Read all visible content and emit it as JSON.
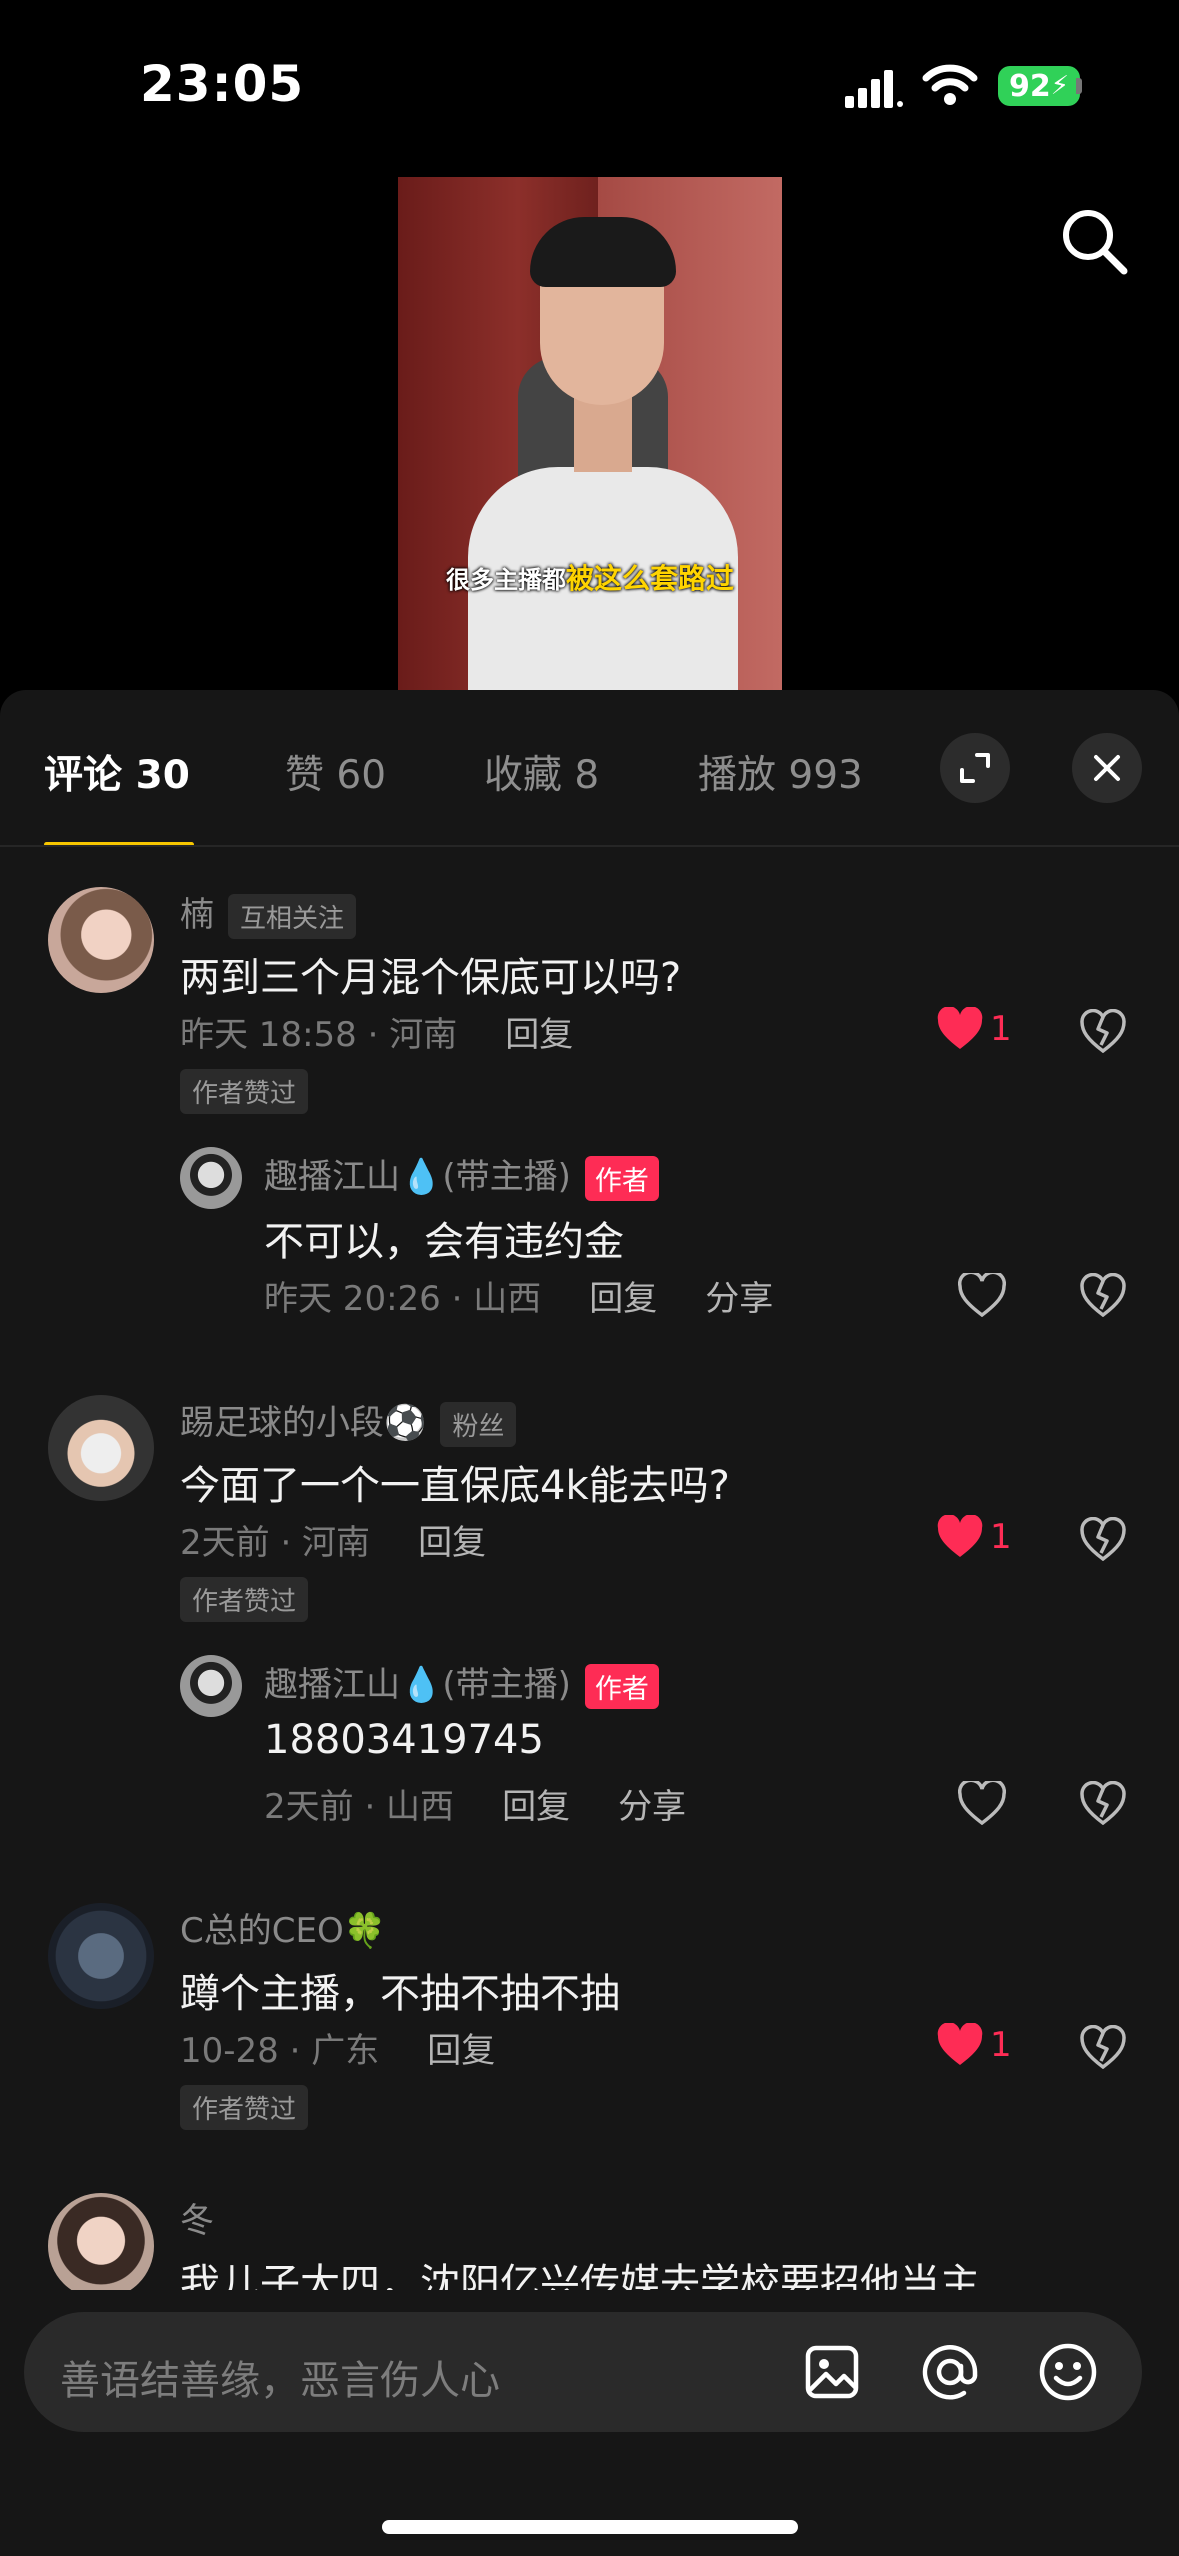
{
  "status": {
    "time": "23:05",
    "battery": "92"
  },
  "video": {
    "caption_plain": "很多主播都",
    "caption_highlight": "被这么套路过"
  },
  "tabs": {
    "comments": "评论 30",
    "likes": "赞 60",
    "favorites": "收藏 8",
    "plays": "播放 993"
  },
  "comments": [
    {
      "name": "楠",
      "badge": "互相关注",
      "text": "两到三个月混个保底可以吗?",
      "meta": "昨天 18:58 · 河南",
      "reply": "回复",
      "like_count": "1",
      "liked_label": "作者赞过",
      "reply_item": {
        "name": "趣播江山💧(带主播)",
        "badge": "作者",
        "text": "不可以，会有违约金",
        "meta": "昨天 20:26 · 山西",
        "reply": "回复",
        "share": "分享"
      }
    },
    {
      "name": "踢足球的小段⚽",
      "badge": "粉丝",
      "text": "今面了一个一直保底4k能去吗?",
      "meta": "2天前 · 河南",
      "reply": "回复",
      "like_count": "1",
      "liked_label": "作者赞过",
      "reply_item": {
        "name": "趣播江山💧(带主播)",
        "badge": "作者",
        "text": "18803419745",
        "meta": "2天前 · 山西",
        "reply": "回复",
        "share": "分享"
      }
    },
    {
      "name": "C总的CEO🍀",
      "text": "蹲个主播，不抽不抽不抽",
      "meta": "10-28 · 广东",
      "reply": "回复",
      "like_count": "1",
      "liked_label": "作者赞过"
    },
    {
      "name": "冬",
      "text": "我儿子大四，沈阳亿兴传媒去学校要招他当主"
    }
  ],
  "input": {
    "placeholder": "善语结善缘，恶言伤人心"
  },
  "colors": {
    "accent": "#fe2c55",
    "tab_underline": "#f7c600",
    "panel": "#161616"
  }
}
